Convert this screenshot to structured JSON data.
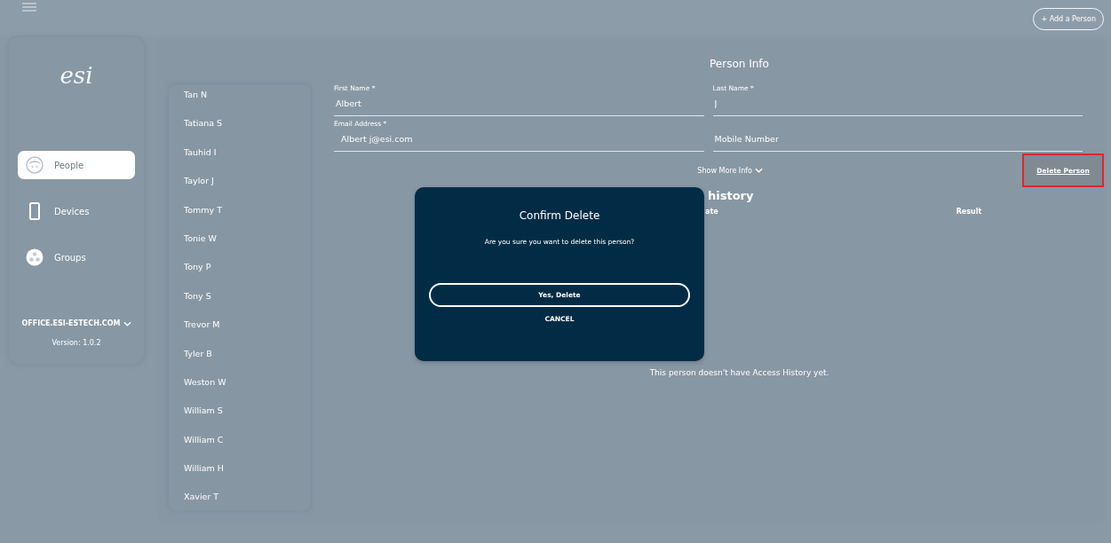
{
  "top_bar": {
    "add_button": "+ Add a Person"
  },
  "sidebar": {
    "logo": "esi",
    "items": [
      {
        "label": "People",
        "kind": "people",
        "selected": true
      },
      {
        "label": "Devices",
        "kind": "devices",
        "selected": false
      },
      {
        "label": "Groups",
        "kind": "groups",
        "selected": false
      }
    ],
    "domain": "OFFICE.ESI-ESTECH.COM",
    "version": "Version: 1.0.2"
  },
  "people_list": [
    "Tan N",
    "Tatiana S",
    "Tauhid I",
    "Taylor J",
    "Tommy T",
    "Tonie W",
    "Tony P",
    "Tony S",
    "Trevor M",
    "Tyler B",
    "Weston W",
    "William S",
    "William C",
    "William H",
    "Xavier T"
  ],
  "person_info": {
    "title": "Person Info",
    "fields": [
      {
        "label": "First Name *",
        "value": "Albert"
      },
      {
        "label": "Last Name *",
        "value": "J"
      },
      {
        "label": "Email Address *",
        "value": "Albert j@esi.com"
      },
      {
        "placeholder": "Mobile Number"
      }
    ],
    "show_more": "Show More Info",
    "delete_button": {
      "label": "Delete Person",
      "highlighted": true
    }
  },
  "access_history": {
    "title": "history",
    "columns": [
      "ate",
      "Result"
    ],
    "empty_text": "This person doesn't have Access History yet."
  },
  "dialog": {
    "title": "Confirm Delete",
    "message": "Are you sure you want to delete this person?",
    "confirm": "Yes, Delete",
    "cancel": "CANCEL"
  }
}
